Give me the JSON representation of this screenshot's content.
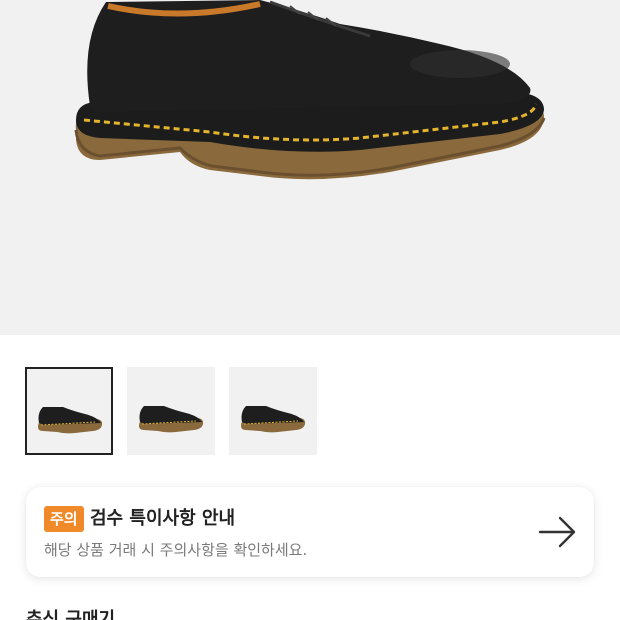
{
  "product": {
    "image_alt": "black leather derby shoe with yellow welt stitching",
    "thumbnails": [
      {
        "icon": "shoe-thumbnail",
        "selected": true
      },
      {
        "icon": "shoe-thumbnail",
        "selected": false
      },
      {
        "icon": "shoe-thumbnail",
        "selected": false
      }
    ]
  },
  "notice": {
    "badge": "주의",
    "title": "검수 특이사항 안내",
    "description": "해당 상품 거래 시 주의사항을 확인하세요.",
    "arrow_icon": "arrow-right-icon",
    "badge_color": "#f08a29"
  },
  "next_section": {
    "title": "추신 구매기"
  }
}
